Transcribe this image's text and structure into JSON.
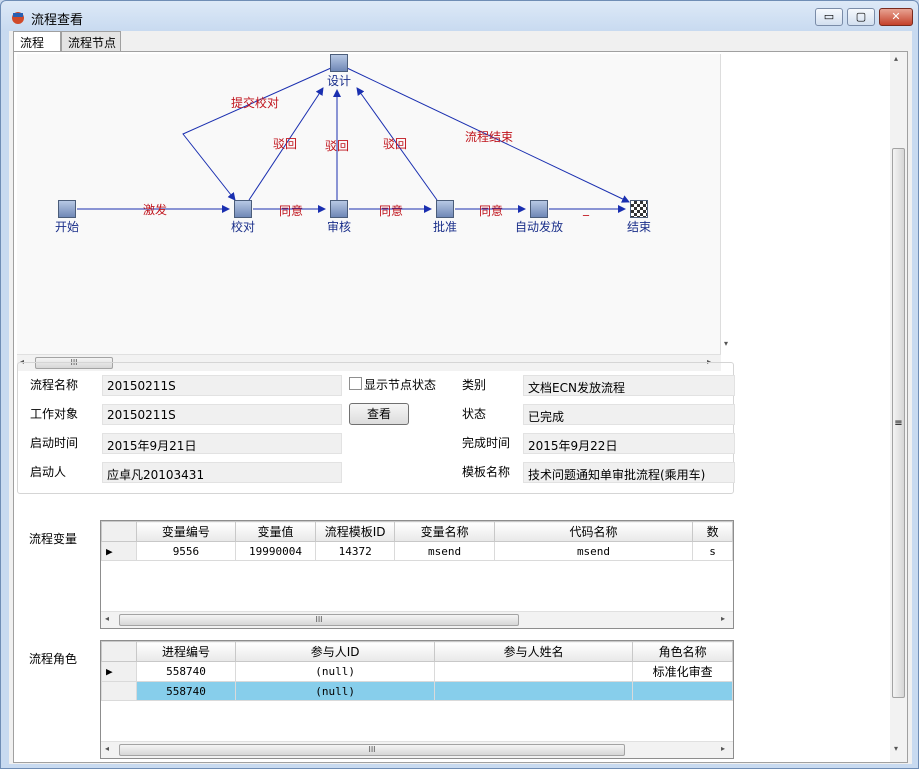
{
  "window": {
    "title": "流程查看",
    "buttons": {
      "minimize": "▭",
      "maximize": "▢",
      "close": "✕"
    }
  },
  "tabs": [
    {
      "label": "流程"
    },
    {
      "label": "流程节点"
    }
  ],
  "diagram": {
    "nodes": [
      {
        "id": "start",
        "label": "开始"
      },
      {
        "id": "check",
        "label": "校对"
      },
      {
        "id": "design",
        "label": "设计"
      },
      {
        "id": "review",
        "label": "审核"
      },
      {
        "id": "approve",
        "label": "批准"
      },
      {
        "id": "autorelease",
        "label": "自动发放"
      },
      {
        "id": "end",
        "label": "结束"
      }
    ],
    "edges": [
      {
        "from": "start",
        "to": "check",
        "label": "激发"
      },
      {
        "from": "check",
        "to": "review",
        "label": "同意"
      },
      {
        "from": "review",
        "to": "approve",
        "label": "同意"
      },
      {
        "from": "approve",
        "to": "autorelease",
        "label": "同意"
      },
      {
        "from": "autorelease",
        "to": "end",
        "label": "_"
      },
      {
        "from": "design",
        "to": "check",
        "label": "提交校对"
      },
      {
        "from": "check",
        "to": "design",
        "label": "驳回"
      },
      {
        "from": "review",
        "to": "design",
        "label": "驳回"
      },
      {
        "from": "approve",
        "to": "design",
        "label": "驳回"
      },
      {
        "from": "design",
        "to": "end",
        "label": "流程结束"
      }
    ],
    "colors": {
      "edge": "#1a2fb0",
      "label": "#c0141c",
      "node_label": "#1a2f8a"
    }
  },
  "info": {
    "flow_name_label": "流程名称",
    "flow_name": "20150211S",
    "show_status_label": "显示节点状态",
    "category_label": "类别",
    "category": "文档ECN发放流程",
    "work_object_label": "工作对象",
    "work_object": "20150211S",
    "view_button": "查看",
    "state_label": "状态",
    "state": "已完成",
    "start_time_label": "启动时间",
    "start_time": "2015年9月21日",
    "finish_time_label": "完成时间",
    "finish_time": "2015年9月22日",
    "starter_label": "启动人",
    "starter": "应卓凡20103431",
    "template_label": "模板名称",
    "template": "技术问题通知单审批流程(乘用车)"
  },
  "variables": {
    "label": "流程变量",
    "columns": [
      "变量编号",
      "变量值",
      "流程模板ID",
      "变量名称",
      "代码名称",
      "数"
    ],
    "rows": [
      {
        "marker": "▶",
        "cells": [
          "9556",
          "19990004",
          "14372",
          "msend",
          "msend",
          "s"
        ]
      }
    ]
  },
  "roles": {
    "label": "流程角色",
    "columns": [
      "进程编号",
      "参与人ID",
      "参与人姓名",
      "角色名称"
    ],
    "rows": [
      {
        "marker": "▶",
        "cells": [
          "558740",
          "(null)",
          "",
          "标准化审查"
        ]
      },
      {
        "marker": "",
        "cells": [
          "558740",
          "(null)",
          "",
          ""
        ]
      }
    ]
  },
  "scroll": {
    "left_arrow": "◂",
    "right_arrow": "▸",
    "up_arrow": "▴",
    "down_arrow": "▾",
    "grip": "III",
    "vgrip": "≡"
  }
}
